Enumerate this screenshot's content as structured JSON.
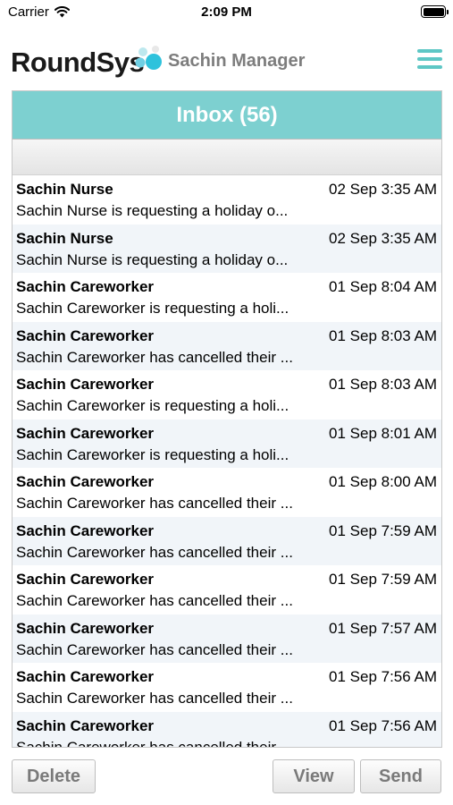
{
  "status_bar": {
    "carrier": "Carrier",
    "time": "2:09 PM"
  },
  "header": {
    "logo_text": "RoundSys",
    "title": "Sachin Manager",
    "menu_icon": "hamburger-menu-icon",
    "accent_color": "#5ec7c5"
  },
  "inbox": {
    "title": "Inbox (56)",
    "header_color": "#7dd0d0",
    "messages": [
      {
        "sender": "Sachin Nurse",
        "time": "02 Sep 3:35 AM",
        "preview": "Sachin Nurse is requesting a holiday o..."
      },
      {
        "sender": "Sachin Nurse",
        "time": "02 Sep 3:35 AM",
        "preview": "Sachin Nurse is requesting a holiday o..."
      },
      {
        "sender": "Sachin Careworker",
        "time": "01 Sep 8:04 AM",
        "preview": "Sachin Careworker is requesting a holi..."
      },
      {
        "sender": "Sachin Careworker",
        "time": "01 Sep 8:03 AM",
        "preview": "Sachin Careworker has cancelled their ..."
      },
      {
        "sender": "Sachin Careworker",
        "time": "01 Sep 8:03 AM",
        "preview": "Sachin Careworker is requesting a holi..."
      },
      {
        "sender": "Sachin Careworker",
        "time": "01 Sep 8:01 AM",
        "preview": "Sachin Careworker is requesting a holi..."
      },
      {
        "sender": "Sachin Careworker",
        "time": "01 Sep 8:00 AM",
        "preview": "Sachin Careworker has cancelled their ..."
      },
      {
        "sender": "Sachin Careworker",
        "time": "01 Sep 7:59 AM",
        "preview": "Sachin Careworker has cancelled their ..."
      },
      {
        "sender": "Sachin Careworker",
        "time": "01 Sep 7:59 AM",
        "preview": "Sachin Careworker has cancelled their ..."
      },
      {
        "sender": "Sachin Careworker",
        "time": "01 Sep 7:57 AM",
        "preview": "Sachin Careworker has cancelled their ..."
      },
      {
        "sender": "Sachin Careworker",
        "time": "01 Sep 7:56 AM",
        "preview": "Sachin Careworker has cancelled their ..."
      },
      {
        "sender": "Sachin Careworker",
        "time": "01 Sep 7:56 AM",
        "preview": "Sachin Careworker has cancelled their ..."
      }
    ]
  },
  "buttons": {
    "delete": "Delete",
    "view": "View",
    "send": "Send"
  }
}
